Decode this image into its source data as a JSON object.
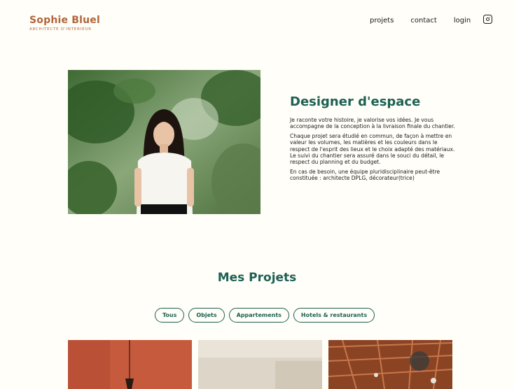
{
  "header": {
    "logo_title": "Sophie Bluel",
    "logo_subtitle": "ARCHITECTE D'INTERIEUR",
    "nav": [
      {
        "label": "projets"
      },
      {
        "label": "contact"
      },
      {
        "label": "login"
      }
    ],
    "social_icon": "instagram-icon"
  },
  "intro": {
    "title": "Designer d'espace",
    "paragraphs": [
      "Je raconte votre histoire, je valorise vos idées. Je vous accompagne de la conception à la livraison finale du chantier.",
      "Chaque projet sera étudié en commun, de façon à mettre en valeur les volumes, les matières et les couleurs dans le respect de l'esprit des lieux et le choix adapté des matériaux. Le suivi du chantier sera assuré dans le souci du détail, le respect du planning et du budget.",
      "En cas de besoin, une équipe pluridisciplinaire peut-être constituée : architecte DPLG, décorateur(trice)"
    ]
  },
  "projects": {
    "title": "Mes Projets",
    "filters": [
      {
        "label": "Tous"
      },
      {
        "label": "Objets"
      },
      {
        "label": "Appartements"
      },
      {
        "label": "Hotels & restaurants"
      }
    ]
  },
  "colors": {
    "brand": "#B1663C",
    "accent": "#1D6154",
    "background": "#FFFEF8"
  }
}
